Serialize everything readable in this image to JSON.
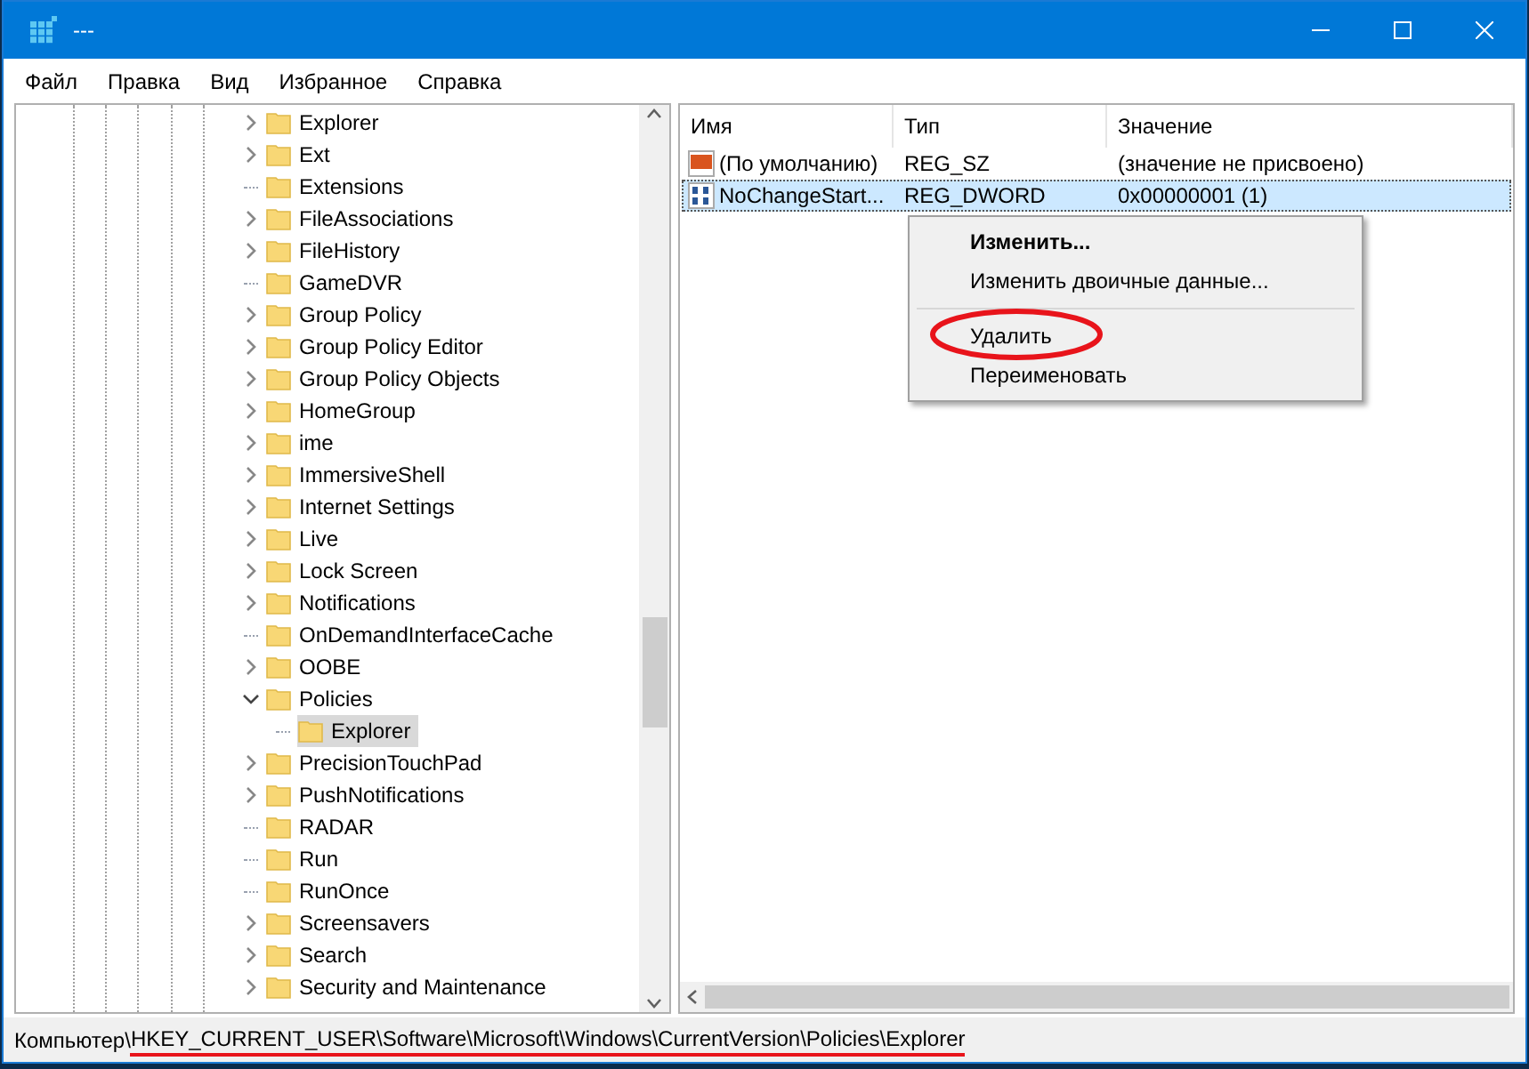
{
  "window": {
    "title": "---"
  },
  "menu": [
    "Файл",
    "Правка",
    "Вид",
    "Избранное",
    "Справка"
  ],
  "tree": [
    {
      "label": "Explorer",
      "kind": "collapsed",
      "selected": false
    },
    {
      "label": "Ext",
      "kind": "collapsed",
      "selected": false
    },
    {
      "label": "Extensions",
      "kind": "leaf",
      "selected": false
    },
    {
      "label": "FileAssociations",
      "kind": "collapsed",
      "selected": false
    },
    {
      "label": "FileHistory",
      "kind": "collapsed",
      "selected": false
    },
    {
      "label": "GameDVR",
      "kind": "leaf",
      "selected": false
    },
    {
      "label": "Group Policy",
      "kind": "collapsed",
      "selected": false
    },
    {
      "label": "Group Policy Editor",
      "kind": "collapsed",
      "selected": false
    },
    {
      "label": "Group Policy Objects",
      "kind": "collapsed",
      "selected": false
    },
    {
      "label": "HomeGroup",
      "kind": "collapsed",
      "selected": false
    },
    {
      "label": "ime",
      "kind": "collapsed",
      "selected": false
    },
    {
      "label": "ImmersiveShell",
      "kind": "collapsed",
      "selected": false
    },
    {
      "label": "Internet Settings",
      "kind": "collapsed",
      "selected": false
    },
    {
      "label": "Live",
      "kind": "collapsed",
      "selected": false
    },
    {
      "label": "Lock Screen",
      "kind": "collapsed",
      "selected": false
    },
    {
      "label": "Notifications",
      "kind": "collapsed",
      "selected": false
    },
    {
      "label": "OnDemandInterfaceCache",
      "kind": "leaf",
      "selected": false
    },
    {
      "label": "OOBE",
      "kind": "collapsed",
      "selected": false
    },
    {
      "label": "Policies",
      "kind": "expanded",
      "selected": false,
      "children": [
        {
          "label": "Explorer",
          "kind": "leaf",
          "selected": true
        }
      ]
    },
    {
      "label": "PrecisionTouchPad",
      "kind": "collapsed",
      "selected": false
    },
    {
      "label": "PushNotifications",
      "kind": "collapsed",
      "selected": false
    },
    {
      "label": "RADAR",
      "kind": "leaf",
      "selected": false
    },
    {
      "label": "Run",
      "kind": "leaf",
      "selected": false
    },
    {
      "label": "RunOnce",
      "kind": "leaf",
      "selected": false
    },
    {
      "label": "Screensavers",
      "kind": "collapsed",
      "selected": false
    },
    {
      "label": "Search",
      "kind": "collapsed",
      "selected": false
    },
    {
      "label": "Security and Maintenance",
      "kind": "collapsed",
      "selected": false
    }
  ],
  "table": {
    "columns": [
      "Имя",
      "Тип",
      "Значение"
    ],
    "rows": [
      {
        "kind": "string",
        "name": "(По умолчанию)",
        "type": "REG_SZ",
        "value": "(значение не присвоено)",
        "selected": false
      },
      {
        "kind": "binary",
        "name": "NoChangeStart...",
        "type": "REG_DWORD",
        "value": "0x00000001 (1)",
        "selected": true
      }
    ]
  },
  "context_menu": [
    {
      "label": "Изменить...",
      "bold": true,
      "highlighted": false
    },
    {
      "label": "Изменить двоичные данные...",
      "bold": false,
      "highlighted": false
    },
    {
      "label": "Удалить",
      "bold": false,
      "highlighted": true
    },
    {
      "label": "Переименовать",
      "bold": false,
      "highlighted": false
    }
  ],
  "status_bar": {
    "prefix": "Компьютер\\",
    "path": "HKEY_CURRENT_USER\\Software\\Microsoft\\Windows\\CurrentVersion\\Policies\\Explorer"
  }
}
